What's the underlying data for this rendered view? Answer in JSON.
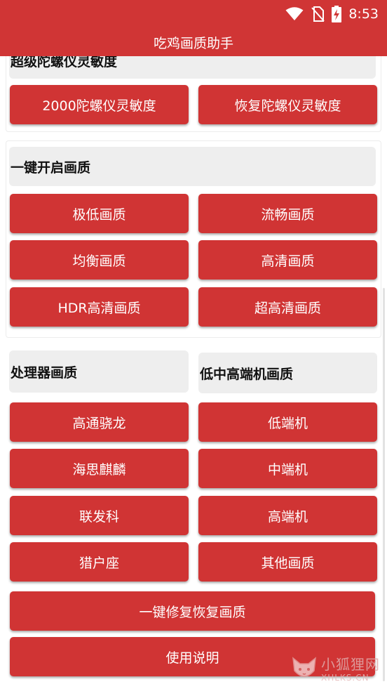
{
  "status": {
    "time": "8:53"
  },
  "app": {
    "title": "吃鸡画质助手"
  },
  "gyro": {
    "header": "超级陀螺仪灵敏度",
    "buttons": [
      "2000陀螺仪灵敏度",
      "恢复陀螺仪灵敏度"
    ]
  },
  "quality": {
    "header": "一键开启画质",
    "buttons": [
      "极低画质",
      "流畅画质",
      "均衡画质",
      "高清画质",
      "HDR高清画质",
      "超高清画质"
    ]
  },
  "processor": {
    "header": "处理器画质",
    "buttons": [
      "高通骁龙",
      "海思麒麟",
      "联发科",
      "猎户座"
    ]
  },
  "device": {
    "header": "低中高端机画质",
    "buttons": [
      "低端机",
      "中端机",
      "高端机",
      "其他画质"
    ]
  },
  "actions": {
    "repair": "一键修复恢复画质",
    "instructions": "使用说明"
  },
  "watermark": {
    "text": "小狐狸网",
    "sub": "XHLKS.CN"
  },
  "colors": {
    "accent": "#d03535",
    "header_bg": "#eeeeee"
  }
}
